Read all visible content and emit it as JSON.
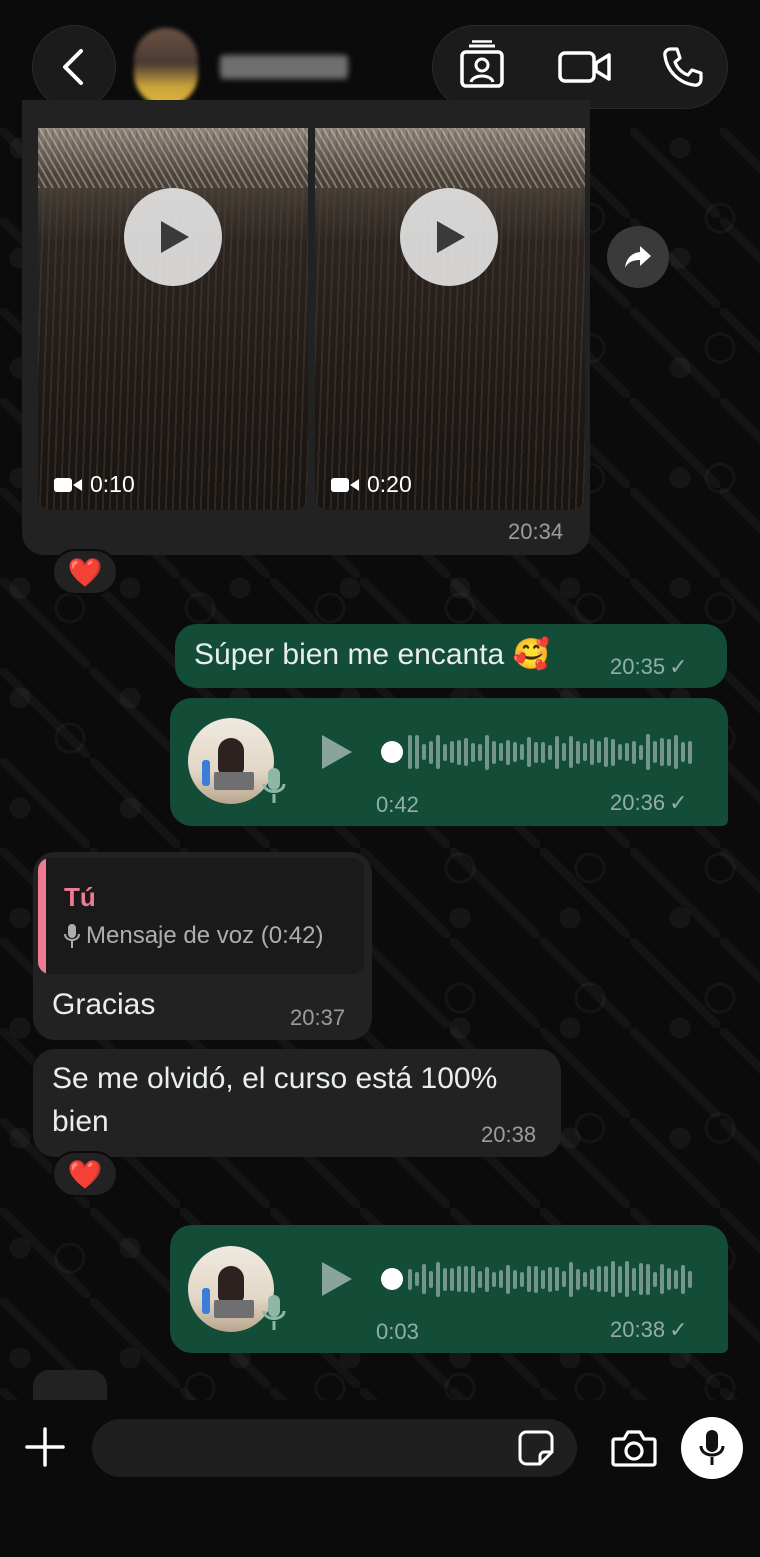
{
  "header": {
    "back_icon": "chevron-left-icon",
    "contact_name": "",
    "actions": [
      "contact-card-icon",
      "video-call-icon",
      "voice-call-icon"
    ]
  },
  "messages": {
    "video_group": {
      "videos": [
        {
          "duration": "0:10"
        },
        {
          "duration": "0:20"
        }
      ],
      "time": "20:34",
      "reaction": "❤️"
    },
    "out_text_1": {
      "text": "Súper bien me encanta 🥰",
      "time": "20:35",
      "check": "✓"
    },
    "voice_1": {
      "duration": "0:42",
      "time": "20:36",
      "check": "✓"
    },
    "reply_1": {
      "quote_author": "Tú",
      "quote_text": "Mensaje de voz (0:42)",
      "text": "Gracias",
      "time": "20:37"
    },
    "in_text_2": {
      "line1": "Se me olvidó, el curso está 100%",
      "line2": "bien",
      "time": "20:38",
      "reaction": "❤️"
    },
    "voice_2": {
      "duration": "0:03",
      "time": "20:38",
      "check": "✓"
    }
  },
  "composer": {
    "placeholder": "",
    "plus_icon": "plus-icon",
    "sticker_icon": "sticker-icon",
    "camera_icon": "camera-icon",
    "mic_icon": "microphone-icon"
  },
  "colors": {
    "background": "#0b0b0b",
    "incoming_bubble": "#222222",
    "outgoing_bubble": "#134d37",
    "quote_accent": "#ee7b93"
  }
}
